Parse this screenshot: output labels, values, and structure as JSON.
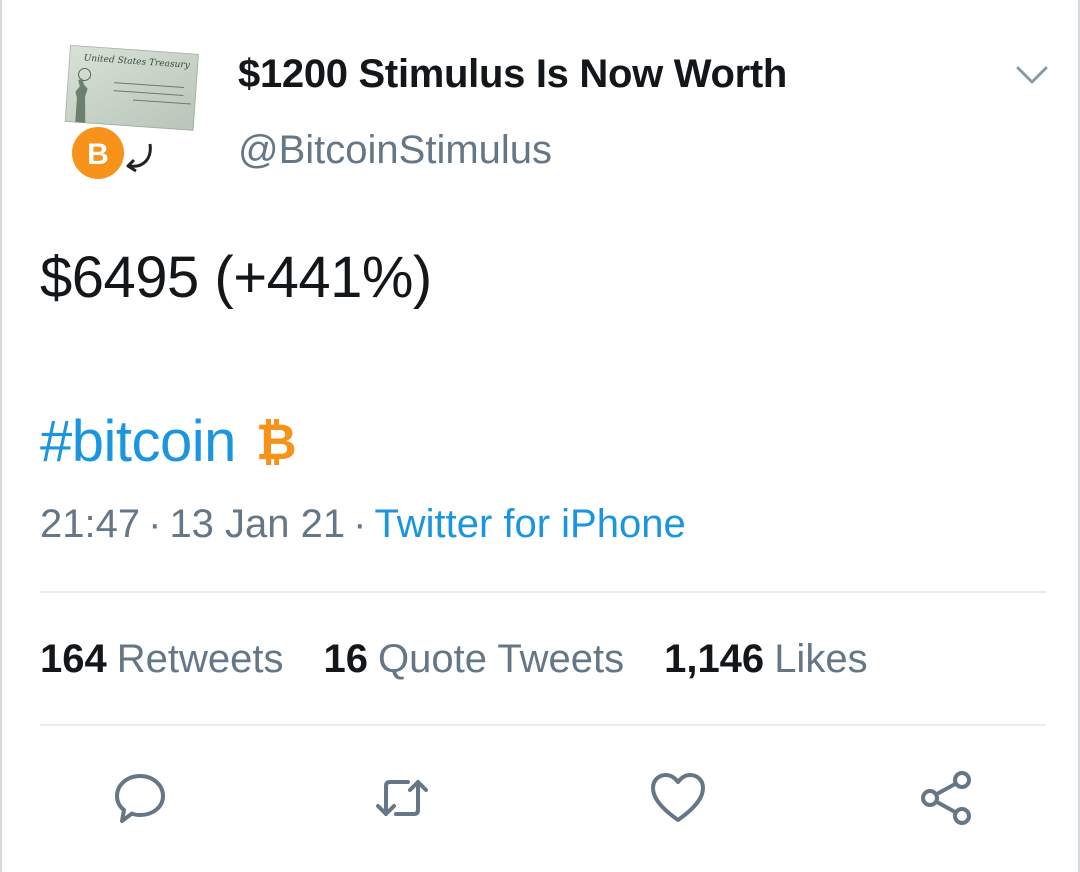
{
  "tweet": {
    "display_name": "$1200 Stimulus Is Now Worth",
    "handle": "@BitcoinStimulus",
    "text": "$6495 (+441%)",
    "hashtag": "#bitcoin",
    "hashtag_symbol": "₿",
    "time": "21:47",
    "date": "13 Jan 21",
    "separator": "·",
    "source": "Twitter for iPhone"
  },
  "avatar": {
    "check_header": "United States Treasury",
    "badge_letter": "B"
  },
  "stats": [
    {
      "count": "164",
      "label": "Retweets"
    },
    {
      "count": "16",
      "label": "Quote Tweets"
    },
    {
      "count": "1,146",
      "label": "Likes"
    }
  ],
  "colors": {
    "link": "#1b95e0",
    "secondary_text": "#657786",
    "primary_text": "#14171a",
    "bitcoin_orange": "#f7931a",
    "divider": "#e6ecf0"
  },
  "icons": {
    "caret": "chevron-down-icon",
    "reply": "reply-icon",
    "retweet": "retweet-icon",
    "like": "heart-icon",
    "share": "share-icon"
  }
}
